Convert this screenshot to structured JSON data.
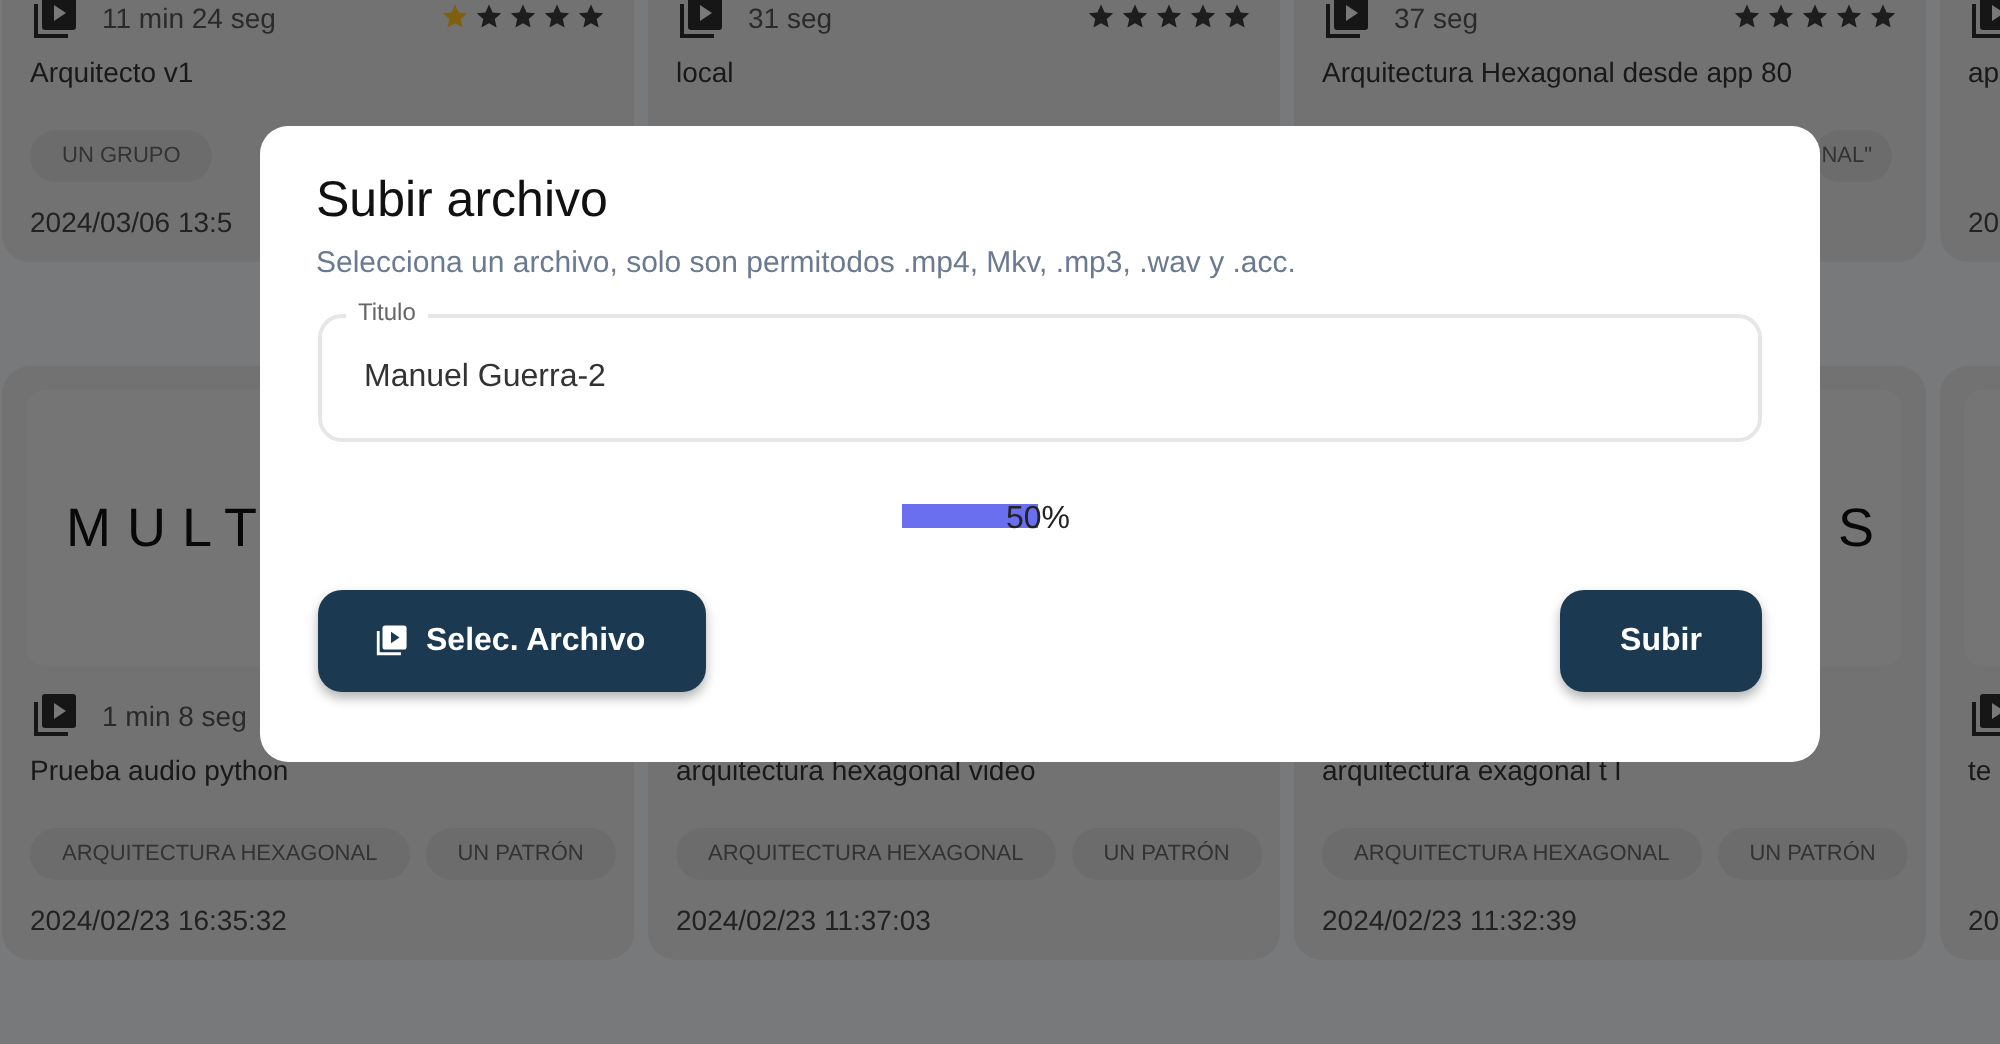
{
  "background_cards": [
    {
      "media_icon": true,
      "duration": "11 min 24 seg",
      "stars": 1,
      "title": "Arquitecto v1",
      "tags": [
        {
          "label": "UN GRUPO",
          "cut": false
        }
      ],
      "date": "2024/03/06 13:5"
    },
    {
      "media_icon": true,
      "duration": "31 seg",
      "stars": 0,
      "title": "local"
    },
    {
      "media_icon": true,
      "duration": "37 seg",
      "stars": 0,
      "title": "Arquitectura Hexagonal desde app 80",
      "tags": [
        {
          "label": "NAL\"",
          "cut": true
        }
      ]
    },
    {
      "media_icon": true,
      "title": "ap",
      "date": "20"
    },
    {
      "thumbnail_text": "MULT",
      "thumbnail_cut_left": false,
      "media_icon": true,
      "duration": "1 min 8 seg",
      "title": "Prueba audio python",
      "tags": [
        {
          "label": "ARQUITECTURA HEXAGONAL",
          "cut": false
        },
        {
          "label": "UN PATRÓN",
          "cut": false
        }
      ],
      "date": "2024/02/23 16:35:32"
    },
    {
      "media_icon": false,
      "title": "arquitectura hexagonal video",
      "tags": [
        {
          "label": "ARQUITECTURA HEXAGONAL",
          "cut": false
        },
        {
          "label": "UN PATRÓN",
          "cut": false
        }
      ],
      "date": "2024/02/23 11:37:03"
    },
    {
      "thumbnail_text": "S",
      "thumbnail_cut_left": true,
      "media_icon": false,
      "title": "arquitectura exagonal t l",
      "tags": [
        {
          "label": "ARQUITECTURA HEXAGONAL",
          "cut": false
        },
        {
          "label": "UN PATRÓN",
          "cut": false
        }
      ],
      "date": "2024/02/23 11:32:39"
    },
    {
      "media_icon": true,
      "title": "te",
      "date": "20"
    }
  ],
  "dialog": {
    "title": "Subir archivo",
    "subtitle": "Selecciona un archivo, solo son permitodos .mp4, Mkv, .mp3, .wav y .acc.",
    "title_field": {
      "label": "Titulo",
      "value": "Manuel Guerra-2"
    },
    "progress": {
      "level": 0.5,
      "reading": "50%"
    },
    "buttons": [
      {
        "label": "Selec. Archivo",
        "kind": "select"
      },
      {
        "label": "Subir",
        "kind": "submit"
      }
    ]
  }
}
